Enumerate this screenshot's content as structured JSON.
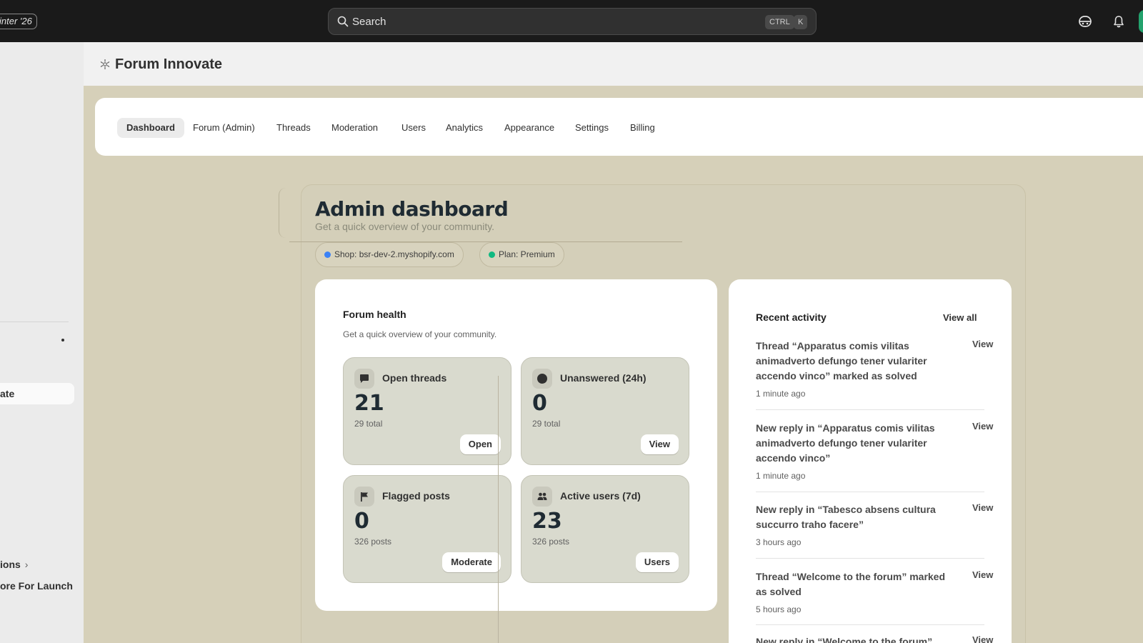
{
  "topbar": {
    "badge": "inter '26",
    "search_placeholder": "Search",
    "kbd_ctrl": "CTRL",
    "kbd_k": "K"
  },
  "sidebar": {
    "active_item": "ate",
    "items": [
      {
        "label": "ions",
        "has_chevron": true
      },
      {
        "label": "ore For Launch"
      }
    ],
    "chevron": "›"
  },
  "app": {
    "title": "Forum Innovate"
  },
  "nav": {
    "tabs": [
      "Dashboard",
      "Forum (Admin)",
      "Threads",
      "Moderation",
      "Users",
      "Analytics",
      "Appearance",
      "Settings",
      "Billing"
    ],
    "active": "Dashboard"
  },
  "dashboard": {
    "title": "Admin dashboard",
    "subtitle": "Get a quick overview of your community.",
    "pills": [
      {
        "label": "Shop: bsr-dev-2.myshopify.com",
        "color": "#3b82f6"
      },
      {
        "label": "Plan: Premium",
        "color": "#10b981"
      }
    ]
  },
  "health": {
    "title": "Forum health",
    "subtitle": "Get a quick overview of your community.",
    "stats": [
      {
        "name": "Open threads",
        "value": "21",
        "sub": "29 total",
        "button": "Open",
        "icon": "chat-bubble-icon"
      },
      {
        "name": "Unanswered (24h)",
        "value": "0",
        "sub": "29 total",
        "button": "View",
        "icon": "circle-icon"
      },
      {
        "name": "Flagged posts",
        "value": "0",
        "sub": "326 posts",
        "button": "Moderate",
        "icon": "flag-icon"
      },
      {
        "name": "Active users (7d)",
        "value": "23",
        "sub": "326 posts",
        "button": "Users",
        "icon": "users-icon"
      }
    ]
  },
  "activity": {
    "title": "Recent activity",
    "view_all": "View all",
    "items": [
      {
        "text": "Thread “Apparatus comis vilitas animadverto defungo tener vulariter accendo vinco” marked as solved",
        "time": "1 minute ago",
        "action": "View"
      },
      {
        "text": "New reply in “Apparatus comis vilitas animadverto defungo tener vulariter accendo vinco”",
        "time": "1 minute ago",
        "action": "View"
      },
      {
        "text": "New reply in “Tabesco absens cultura succurro traho facere”",
        "time": "3 hours ago",
        "action": "View"
      },
      {
        "text": "Thread “Welcome to the forum” marked as solved",
        "time": "5 hours ago",
        "action": "View"
      },
      {
        "text": "New reply in “Welcome to the forum”",
        "time": "",
        "action": "View"
      }
    ]
  }
}
